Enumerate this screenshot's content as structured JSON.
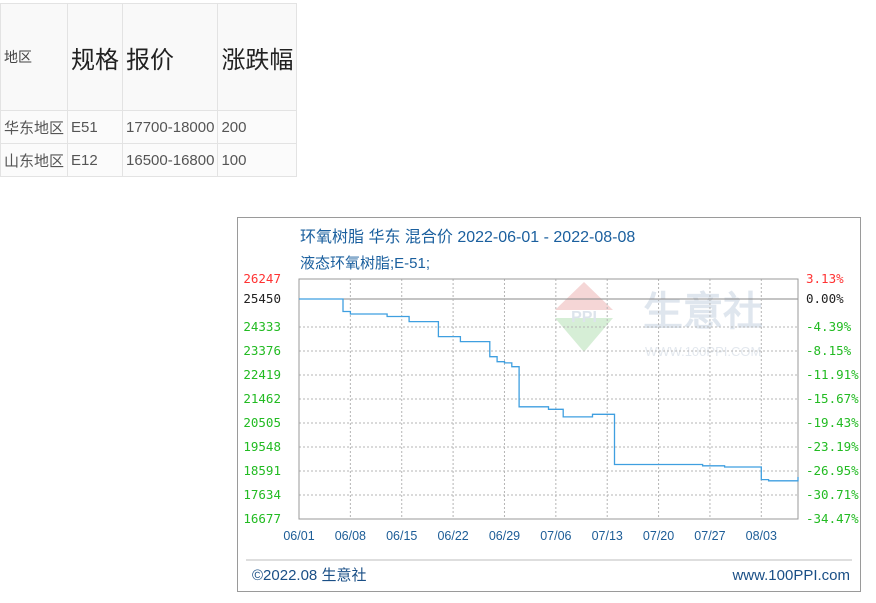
{
  "table": {
    "headers": [
      "地区",
      "规格",
      "报价",
      "涨跌幅"
    ],
    "rows": [
      [
        "华东地区",
        "E51",
        "17700-18000",
        "200"
      ],
      [
        "山东地区",
        "E12",
        "16500-16800",
        "100"
      ]
    ]
  },
  "chart": {
    "watermark": {
      "text": "生意社",
      "url": "WWW.100PPI.COM",
      "logo": "PPI"
    },
    "footer": {
      "copyright": "©2022.08 生意社",
      "site": "www.100PPI.com"
    },
    "colors": {
      "line": "#3f9fe0",
      "up": "#ff3333",
      "down": "#22bb22",
      "base": "#222222",
      "grid": "#b5b5b5",
      "title": "#1a5f9e"
    }
  },
  "chart_data": {
    "type": "line",
    "title": "环氧树脂 华东 混合价 2022-06-01 - 2022-08-08",
    "subtitle": "液态环氧树脂;E-51;",
    "x_tick_labels": [
      "06/01",
      "06/08",
      "06/15",
      "06/22",
      "06/29",
      "07/06",
      "07/13",
      "07/20",
      "07/27",
      "08/03"
    ],
    "y_left_ticks": [
      26247,
      25450,
      24333,
      23376,
      22419,
      21462,
      20505,
      19548,
      18591,
      17634,
      16677
    ],
    "y_right_ticks": [
      "3.13%",
      "0.00%",
      "-4.39%",
      "-8.15%",
      "-11.91%",
      "-15.67%",
      "-19.43%",
      "-23.19%",
      "-26.95%",
      "-30.71%",
      "-34.47%"
    ],
    "ylim": [
      16677,
      26247
    ],
    "series": [
      {
        "x": [
          "2022-06-01",
          "2022-06-02",
          "2022-06-03",
          "2022-06-06",
          "2022-06-07",
          "2022-06-08",
          "2022-06-09",
          "2022-06-10",
          "2022-06-13",
          "2022-06-14",
          "2022-06-15",
          "2022-06-16",
          "2022-06-17",
          "2022-06-20",
          "2022-06-21",
          "2022-06-22",
          "2022-06-23",
          "2022-06-24",
          "2022-06-27",
          "2022-06-28",
          "2022-06-29",
          "2022-06-30",
          "2022-07-01",
          "2022-07-04",
          "2022-07-05",
          "2022-07-06",
          "2022-07-07",
          "2022-07-08",
          "2022-07-11",
          "2022-07-12",
          "2022-07-13",
          "2022-07-14",
          "2022-07-15",
          "2022-07-18",
          "2022-07-19",
          "2022-07-20",
          "2022-07-21",
          "2022-07-22",
          "2022-07-25",
          "2022-07-26",
          "2022-07-27",
          "2022-07-28",
          "2022-07-29",
          "2022-08-01",
          "2022-08-02",
          "2022-08-03",
          "2022-08-04",
          "2022-08-05",
          "2022-08-08"
        ],
        "values": [
          25450,
          25450,
          25450,
          25450,
          24950,
          24850,
          24850,
          24850,
          24750,
          24750,
          24750,
          24550,
          24550,
          23950,
          23950,
          23950,
          23750,
          23750,
          23150,
          22950,
          22900,
          22750,
          21150,
          21150,
          21050,
          21050,
          20750,
          20750,
          20850,
          20850,
          20850,
          18850,
          18850,
          18850,
          18850,
          18850,
          18850,
          18850,
          18850,
          18800,
          18800,
          18800,
          18750,
          18750,
          18750,
          18250,
          18200,
          18200,
          18350
        ]
      }
    ]
  }
}
